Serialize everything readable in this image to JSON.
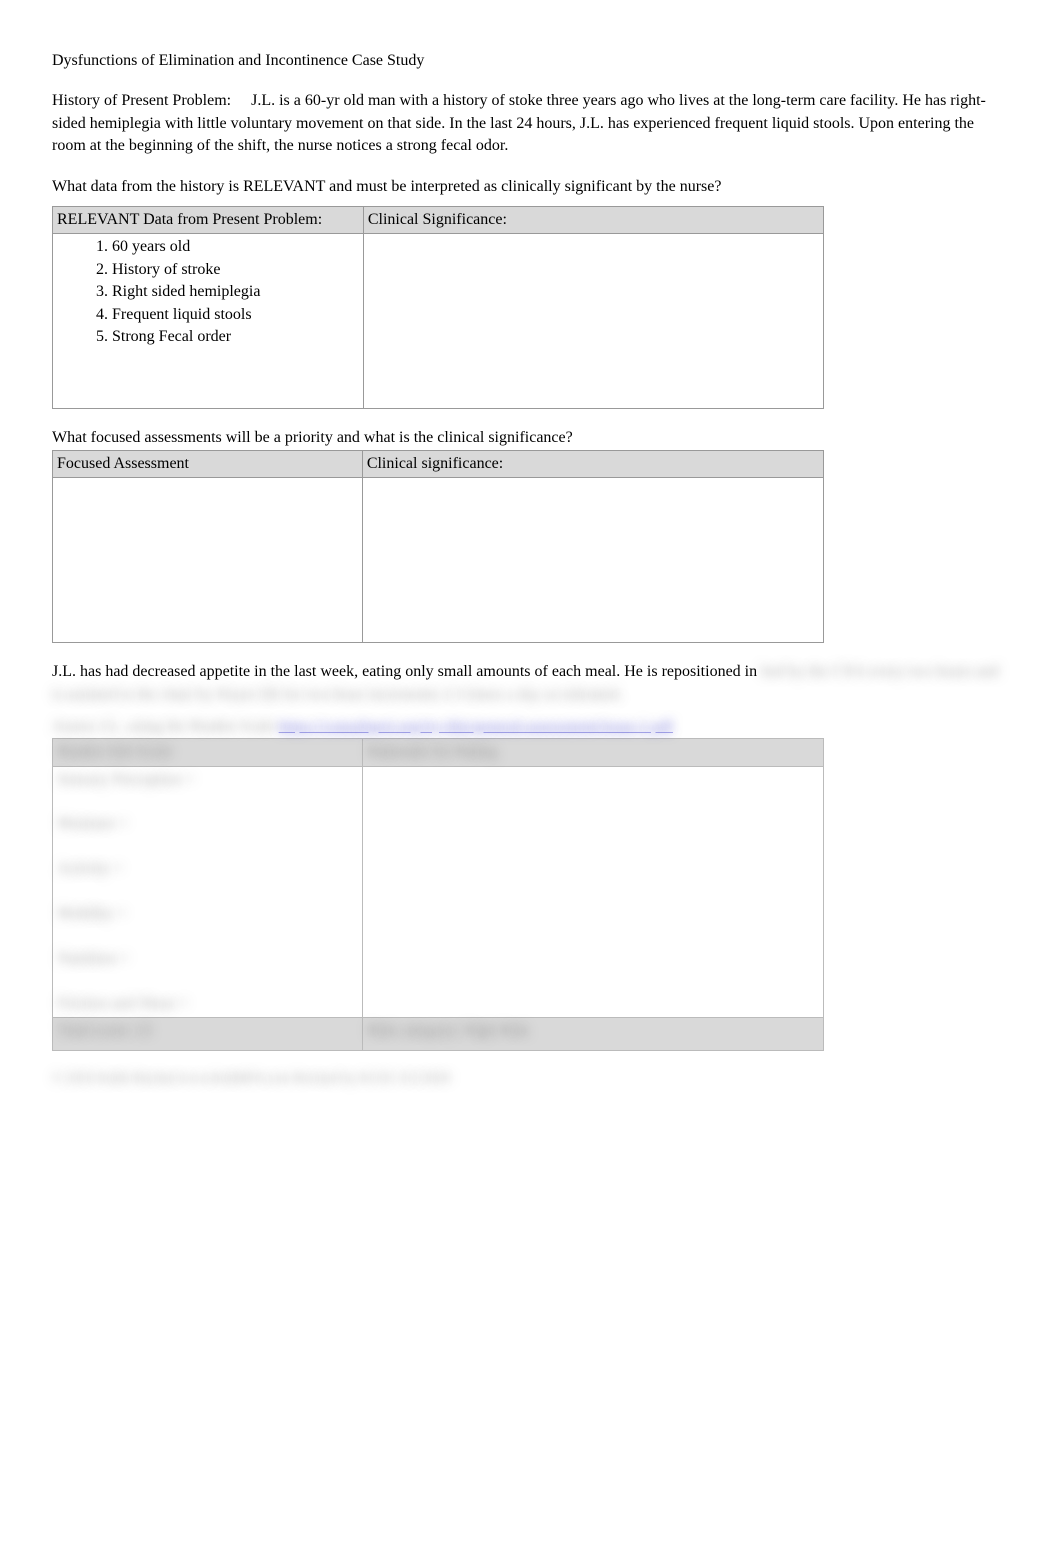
{
  "title": "Dysfunctions of Elimination and Incontinence Case Study",
  "history_label": "History of Present Problem:",
  "history_text": "J.L. is a 60-yr old man with a history of stoke three years ago who lives at the long-term care facility. He has right-sided hemiplegia with little voluntary movement on that side. In the last 24 hours, J.L. has experienced frequent liquid stools. Upon entering the room at the beginning of the shift, the nurse notices a strong fecal odor.",
  "question1": " What data from the history is RELEVANT and must be interpreted as clinically significant by the nurse?",
  "table1": {
    "header_left": "RELEVANT Data from Present Problem:",
    "header_right": "Clinical Significance:",
    "items": [
      "60 years old",
      "History of stroke",
      "Right sided hemiplegia",
      "Frequent liquid stools",
      "Strong Fecal order"
    ]
  },
  "question2": "What focused assessments will be a priority and what is the clinical significance?",
  "table2": {
    "header_left": "Focused Assessment",
    "header_right": "Clinical significance:"
  },
  "narrative2": "J.L. has had decreased appetite in the last week, eating only small amounts of each meal. He is repositioned in",
  "blurred_narrative_cont": "bed by the CNA every two hours and is assisted to the chair by Hoyer lift for two-hour increments 2-3 times a day as tolerated.",
  "blurred_assess_text": "Assess J.L. using the Braden Scale ",
  "blurred_link_text": "https://consultgeri.org/try-this/general-assessment/issue-1.pdf",
  "table3": {
    "header_left": "Braden Sub Score",
    "header_right": "Rationale for Rating",
    "rows": [
      "Sensory Perception =",
      "Moisture =",
      "Activity =",
      "Mobility =",
      "Nutrition =",
      "Friction and Shear ="
    ],
    "footer_left": "Total score: 23",
    "footer_right": "Risk category: High Risk"
  },
  "footer_text": "© 2016 Keith Rischer/www.KeithRN.com       Revised by KGSC 6/1/2020"
}
